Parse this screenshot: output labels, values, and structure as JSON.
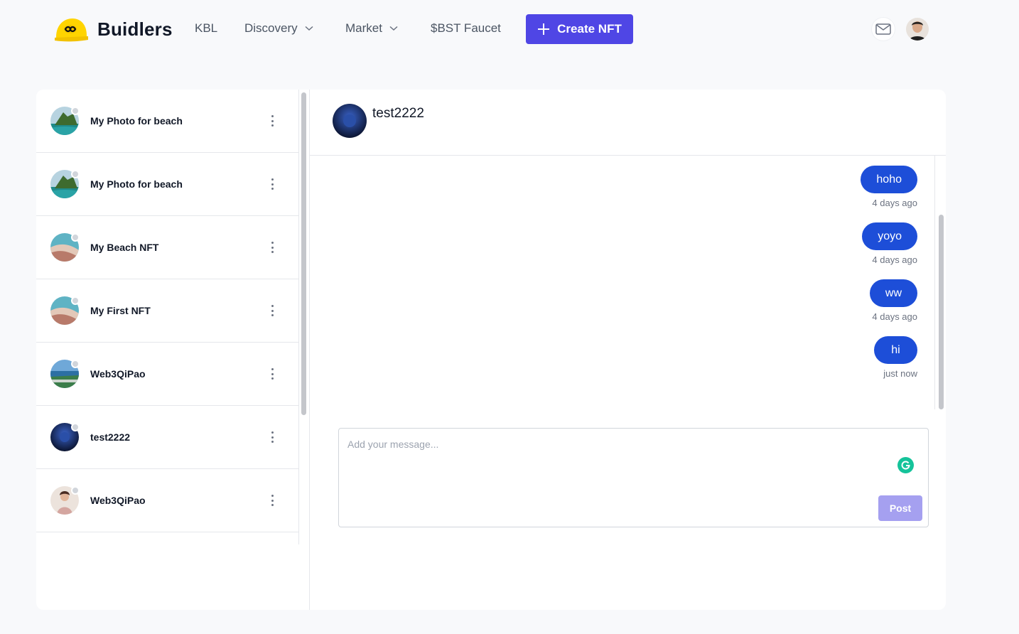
{
  "brand": {
    "name": "Buidlers"
  },
  "nav": {
    "kbl": "KBL",
    "discovery": "Discovery",
    "market": "Market",
    "faucet": "$BST Faucet",
    "create_nft": "Create NFT"
  },
  "conversations": [
    {
      "name": "My Photo for beach",
      "avatar": "island-photo"
    },
    {
      "name": "My Photo for beach",
      "avatar": "island-photo"
    },
    {
      "name": "My Beach NFT",
      "avatar": "beach-photo"
    },
    {
      "name": "My First NFT",
      "avatar": "beach-photo"
    },
    {
      "name": "Web3QiPao",
      "avatar": "coast-photo"
    },
    {
      "name": "test2222",
      "avatar": "dark-blue-orb"
    },
    {
      "name": "Web3QiPao",
      "avatar": "woman-portrait"
    }
  ],
  "chat": {
    "title": "test2222",
    "messages": [
      {
        "text": "hoho",
        "time": "4 days ago"
      },
      {
        "text": "yoyo",
        "time": "4 days ago"
      },
      {
        "text": "ww",
        "time": "4 days ago"
      },
      {
        "text": "hi",
        "time": "just now"
      }
    ],
    "composer": {
      "placeholder": "Add your message...",
      "post_label": "Post"
    }
  },
  "colors": {
    "accent": "#4f46e5",
    "bubble": "#1d4ed8",
    "post_button": "#a5a0f0",
    "grammarly": "#15c39a"
  },
  "icons": [
    "helmet-logo-icon",
    "chevron-down-icon",
    "plus-icon",
    "mail-icon",
    "more-vertical-icon",
    "grammarly-icon"
  ]
}
